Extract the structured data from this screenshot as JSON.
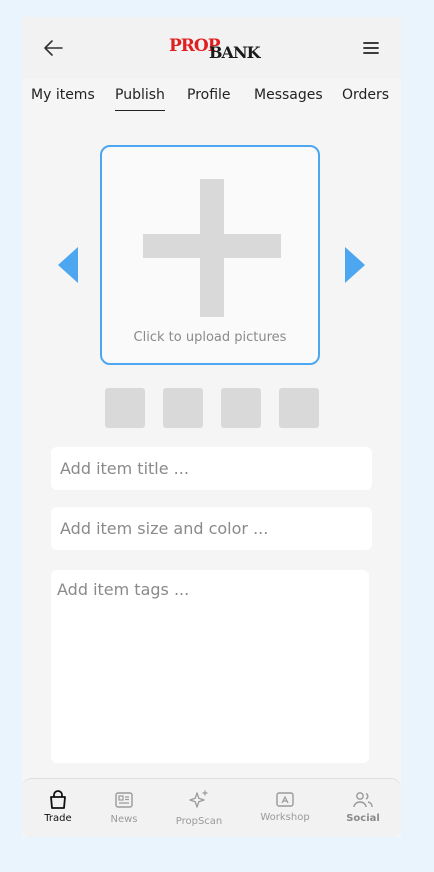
{
  "header": {
    "logo_part1": "PROP",
    "logo_part2": "BANK",
    "back_icon": "arrow-left-icon",
    "menu_icon": "hamburger-menu-icon"
  },
  "tabs": [
    {
      "label": "My items"
    },
    {
      "label": "Publish",
      "active": true
    },
    {
      "label": "Profile"
    },
    {
      "label": "Messages"
    },
    {
      "label": "Orders"
    }
  ],
  "upload": {
    "hint": "Click to upload pictures",
    "accent_color": "#4da6f0"
  },
  "form": {
    "title_placeholder": "Add item title ...",
    "size_color_placeholder": "Add item size and color ...",
    "tags_placeholder": "Add item tags ..."
  },
  "bottom_nav": [
    {
      "label": "Trade",
      "icon": "shopping-bag-icon",
      "active": true
    },
    {
      "label": "News",
      "icon": "newspaper-icon"
    },
    {
      "label": "PropScan",
      "icon": "sparkle-icon"
    },
    {
      "label": "Workshop",
      "icon": "workshop-icon"
    },
    {
      "label": "Social",
      "icon": "people-icon",
      "emphasis": "bold"
    }
  ]
}
